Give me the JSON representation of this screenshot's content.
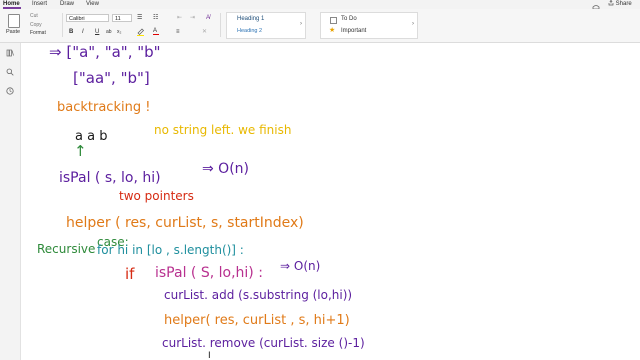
{
  "menu": {
    "items": [
      "Home",
      "Insert",
      "Draw",
      "View"
    ],
    "active": "Home",
    "share_label": "Share"
  },
  "ribbon": {
    "paste_label": "Paste",
    "clipboard": [
      "Cut",
      "Copy",
      "Format"
    ],
    "font_name": "Calibri",
    "font_size": "11",
    "styles": [
      "Heading 1",
      "Heading 2"
    ],
    "tags": [
      "To Do",
      "Important"
    ]
  },
  "colors": {
    "black": "#1a1a1a",
    "purple": "#5b1e9e",
    "orange": "#e07a18",
    "yellow": "#e8b800",
    "green": "#2e8a3a",
    "teal": "#1f8f9e",
    "red": "#d62a12",
    "magenta": "#b8308f",
    "brown": "#9a4e1c"
  },
  "notes": {
    "line1": "⇒ [\"a\", \"a\", \"b\"",
    "line2": "[\"aa\", \"b\"]",
    "backtracking": "backtracking !",
    "aab": "a a b",
    "no_string": "no string left. we finish",
    "arrow_up": "↑",
    "ispal": "isPal ( s, lo, hi)",
    "ispal_complexity": "⇒ O(n)",
    "two_pointers": "two pointers",
    "helper": "helper ( res, curList, s, startIndex)",
    "recursive": "Recursive",
    "case": "case:",
    "for_loop": "for hi in [lo , s.length()] :",
    "if_label": "if",
    "if_cond": "isPal ( S, lo,hi) :",
    "if_complexity": "⇒ O(n)",
    "add_line": "curList. add (s.substring (lo,hi))",
    "helper_call": "helper( res, curList , s, hi+1)",
    "remove_line": "curList. remove (curList. size ()-1)"
  }
}
